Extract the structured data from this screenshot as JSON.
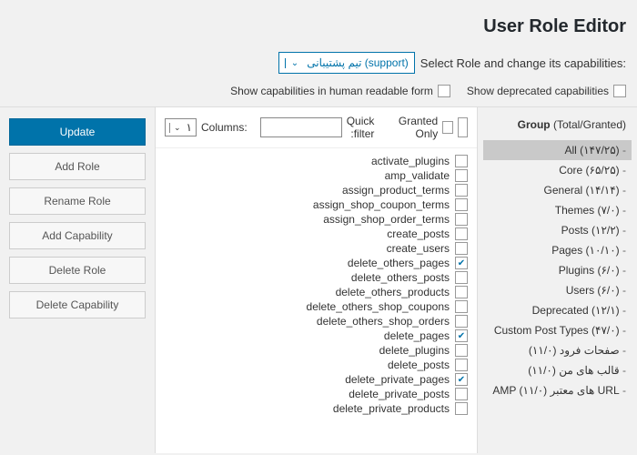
{
  "title": "User Role Editor",
  "selectLabel": ":Select Role and change its capabilities",
  "selectedRole": "تیم پشتیبانی (support)",
  "options": {
    "deprecated": "Show deprecated capabilities",
    "humanReadable": "Show capabilities in human readable form"
  },
  "filter": {
    "columnsLabel": ":Columns",
    "columnsValue": "۱",
    "quickFilterLabel": "Quick filter:",
    "grantedOnly": "Granted Only"
  },
  "groupHeader": {
    "label": "Group",
    "sub": "(Total/Granted)"
  },
  "groups": [
    {
      "name": "All",
      "count": "(۱۴۷/۲۵)",
      "active": true
    },
    {
      "name": "Core",
      "count": "(۶۵/۲۵)"
    },
    {
      "name": "General",
      "count": "(۱۴/۱۴)"
    },
    {
      "name": "Themes",
      "count": "(۷/۰)"
    },
    {
      "name": "Posts",
      "count": "(۱۲/۲)"
    },
    {
      "name": "Pages",
      "count": "(۱۰/۱۰)"
    },
    {
      "name": "Plugins",
      "count": "(۶/۰)"
    },
    {
      "name": "Users",
      "count": "(۶/۰)"
    },
    {
      "name": "Deprecated",
      "count": "(۱۲/۱)"
    },
    {
      "name": "Custom Post Types",
      "count": "(۴۷/۰)"
    },
    {
      "name": "صفحات فرود",
      "count": "(۱۱/۰)",
      "rtl": true
    },
    {
      "name": "قالب های من",
      "count": "(۱۱/۰)",
      "rtl": true
    },
    {
      "name": "URL های معتبر AMP",
      "count": "(۱۱/۰)",
      "rtl": true
    }
  ],
  "capabilities": [
    {
      "name": "activate_plugins",
      "checked": false
    },
    {
      "name": "amp_validate",
      "checked": false
    },
    {
      "name": "assign_product_terms",
      "checked": false
    },
    {
      "name": "assign_shop_coupon_terms",
      "checked": false
    },
    {
      "name": "assign_shop_order_terms",
      "checked": false
    },
    {
      "name": "create_posts",
      "checked": false
    },
    {
      "name": "create_users",
      "checked": false
    },
    {
      "name": "delete_others_pages",
      "checked": true
    },
    {
      "name": "delete_others_posts",
      "checked": false
    },
    {
      "name": "delete_others_products",
      "checked": false
    },
    {
      "name": "delete_others_shop_coupons",
      "checked": false
    },
    {
      "name": "delete_others_shop_orders",
      "checked": false
    },
    {
      "name": "delete_pages",
      "checked": true
    },
    {
      "name": "delete_plugins",
      "checked": false
    },
    {
      "name": "delete_posts",
      "checked": false
    },
    {
      "name": "delete_private_pages",
      "checked": true
    },
    {
      "name": "delete_private_posts",
      "checked": false
    },
    {
      "name": "delete_private_products",
      "checked": false
    }
  ],
  "actions": {
    "update": "Update",
    "addRole": "Add Role",
    "renameRole": "Rename Role",
    "addCapability": "Add Capability",
    "deleteRole": "Delete Role",
    "deleteCapability": "Delete Capability"
  }
}
